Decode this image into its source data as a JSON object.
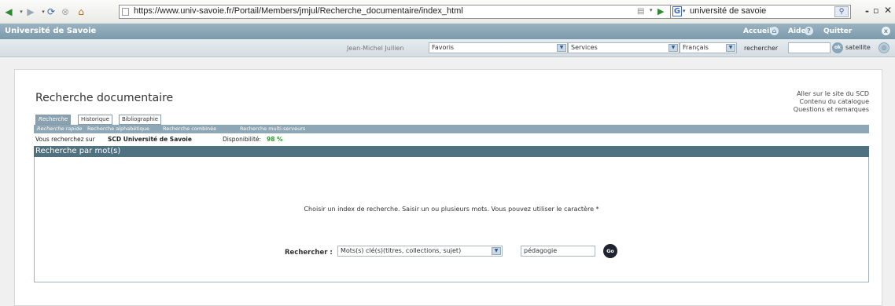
{
  "browser": {
    "url": "https://www.univ-savoie.fr/Portail/Members/jmjul/Recherche_documentaire/index_html",
    "search_value": "université de savoie"
  },
  "site": {
    "title": "Université de Savoie",
    "accueil": "Accueil",
    "aide": "Aide",
    "quitter": "Quitter"
  },
  "userbar": {
    "user": "Jean-Michel Jullien",
    "favoris": "Favoris",
    "services": "Services",
    "language": "Français",
    "rechercher": "rechercher",
    "ok": "ok",
    "satellite": "satellite"
  },
  "page": {
    "heading": "Recherche documentaire",
    "right_links": [
      "Aller sur le site du SCD",
      "Contenu du catalogue",
      "Questions et remarques"
    ],
    "tabs": [
      "Recherche",
      "Historique",
      "Bibliographie"
    ],
    "subtabs": [
      "Recherche rapide",
      "Recherche alphabétique",
      "Recherche combinée",
      "Recherche multi-serveurs"
    ],
    "status_prefix": "Vous recherchez sur",
    "status_catalog": "SCD Université de Savoie",
    "dispo_label": "Disponibilité:",
    "dispo_value": "98 %",
    "section_title": "Recherche par mot(s)",
    "instructions": "Choisir un index de recherche. Saisir un ou plusieurs mots. Vous pouvez utiliser le caractère *",
    "search_label": "Rechercher :",
    "index_selected": "Mots(s) clé(s)(titres, collections, sujet)",
    "query": "pédagogie",
    "go": "Go"
  },
  "colors": {
    "header": "#7c9aab",
    "section": "#4f7180",
    "dispo": "#2a9a2a"
  }
}
